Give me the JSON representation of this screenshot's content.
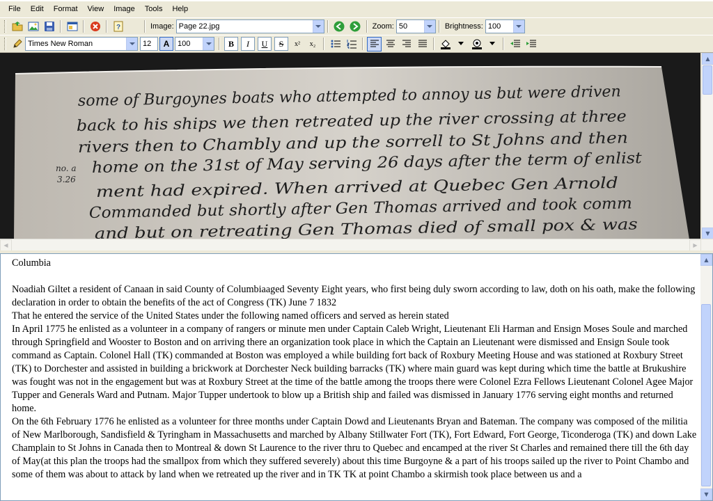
{
  "menu": [
    "File",
    "Edit",
    "Format",
    "View",
    "Image",
    "Tools",
    "Help"
  ],
  "toolbar": {
    "open_icon": "open-folder-icon",
    "image_icon": "image-icon",
    "save_icon": "save-disk-icon",
    "properties_icon": "window-icon",
    "close_icon": "close-icon",
    "help_icon": "help-icon",
    "image_label": "Image:",
    "image_value": "Page 22.jpg",
    "zoom_label": "Zoom:",
    "zoom_value": "50",
    "brightness_label": "Brightness:",
    "brightness_value": "100"
  },
  "format_bar": {
    "font_value": "Times New Roman",
    "size_value": "12",
    "size_icon_label": "A",
    "zoom_value": "100",
    "bold": "B",
    "italic": "I",
    "underline": "U",
    "strike": "S",
    "superscript": "x²",
    "subscript": "x₂"
  },
  "colors": {
    "accent": "#316ac5",
    "nav_green": "#2e9e3a",
    "close_red": "#d93a1e"
  },
  "manuscript": {
    "lines": [
      "some of Burgoynes boats who attempted to annoy us but were driven",
      "back to his ships we then retreated up the river crossing at three",
      "rivers then to Chambly and up the sorrell to St Johns and then",
      "home on the 31st of May serving 26 days after the term of enlist",
      "ment had expired. When arrived at Quebec Gen Arnold",
      "Commanded but shortly after Gen Thomas arrived and took comm",
      "and but on retreating Gen Thomas died of small pox & was"
    ],
    "margin_note": [
      "no. a",
      "3.26"
    ]
  },
  "document": {
    "heading": "Columbia",
    "paragraphs": [
      "Noadiah Giltet a resident of Canaan in said County of Columbiaaged Seventy Eight years, who first being duly sworn according to law, doth on his oath, make the following declaration in order to obtain the benefits of the act of Congress (TK) June 7 1832",
      "That he entered the service of the United States under the following named officers and served as herein stated",
      "In April 1775 he enlisted as a volunteer in a company of rangers or minute men under Captain Caleb Wright, Lieutenant Eli Harman and Ensign Moses Soule and marched through Springfield and Wooster to Boston and on arriving there an organization took place in which the Captain an Lieutenant were dismissed and Ensign Soule took command as Captain. Colonel Hall (TK) commanded at Boston was employed a while building fort back of Roxbury Meeting House and was stationed at Roxbury Street (TK) to Dorchester and assisted in building a brickwork at Dorchester Neck building barracks  (TK) where main guard was kept during which time the battle at Brukushire was fought was not in the engagement but was at Roxbury Street at the time of the battle among the troops there were Colonel Ezra Fellows Lieutenant Colonel Agee Major Tupper and Generals Ward and Putnam. Major Tupper undertook to blow up a British ship and failed was dismissed in January 1776 serving eight months and returned home.",
      "On the 6th February 1776 he enlisted as a volunteer for three months under Captain Dowd and Lieutenants Bryan and Bateman. The company was composed of the militia of New Marlborough, Sandisfield & Tyringham in Massachusetts and marched by Albany Stillwater Fort (TK), Fort Edward, Fort George, Ticonderoga (TK) and down Lake Champlain to St Johns in Canada then to Montreal & down St Laurence to the river thru to Quebec and encamped at the river St Charles and remained there till the 6th day of May(at this plan the troops had the smallpox from which they suffered severely) about this time Burgoyne & a part of his troops sailed up the river to Point Chambo and some of them was about to attack by land when we retreated up the river and in TK TK at point Chambo a skirmish took place between us and a"
    ]
  }
}
